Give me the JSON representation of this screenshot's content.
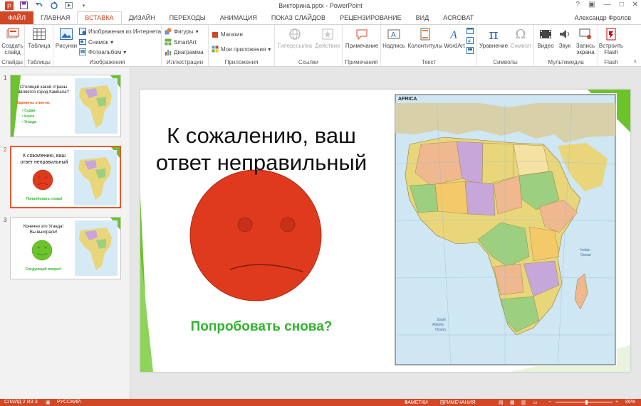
{
  "titlebar": {
    "title": "Викторина.pptx - PowerPoint",
    "qat_icons": [
      "powerpoint-logo",
      "save-icon",
      "undo-icon",
      "redo-icon",
      "start-from-beginning-icon"
    ]
  },
  "tabs": [
    {
      "label": "ФАЙЛ",
      "name": "tab-file"
    },
    {
      "label": "ГЛАВНАЯ",
      "name": "tab-home"
    },
    {
      "label": "ВСТАВКА",
      "name": "tab-insert"
    },
    {
      "label": "ДИЗАЙН",
      "name": "tab-design"
    },
    {
      "label": "ПЕРЕХОДЫ",
      "name": "tab-transitions"
    },
    {
      "label": "АНИМАЦИЯ",
      "name": "tab-animation"
    },
    {
      "label": "ПОКАЗ СЛАЙДОВ",
      "name": "tab-slideshow"
    },
    {
      "label": "РЕЦЕНЗИРОВАНИЕ",
      "name": "tab-review"
    },
    {
      "label": "ВИД",
      "name": "tab-view"
    },
    {
      "label": "ACROBAT",
      "name": "tab-acrobat"
    }
  ],
  "user": "Александр Фролов",
  "ribbon": {
    "slides": {
      "btn": "Создать слайд",
      "label": "Слайды"
    },
    "tables": {
      "btn": "Таблица",
      "label": "Таблицы"
    },
    "images": {
      "pictures": "Рисунки",
      "online": "Изображения из Интернета",
      "screenshot": "Снимок",
      "album": "Фотоальбом",
      "label": "Изображения"
    },
    "illustrations": {
      "shapes": "Фигуры",
      "smartart": "SmartArt",
      "chart": "Диаграмма",
      "label": "Иллюстрации"
    },
    "apps": {
      "store": "Магазин",
      "myapps": "Мои приложения",
      "label": "Приложения"
    },
    "links": {
      "hyperlink": "Гиперссылка",
      "action": "Действие",
      "label": "Ссылки"
    },
    "comments": {
      "comment": "Примечание",
      "label": "Примечания"
    },
    "text": {
      "textbox": "Надпись",
      "headerfooter": "Колонтитулы",
      "wordart": "WordArt",
      "label": "Текст"
    },
    "symbols": {
      "equation": "Уравнение",
      "symbol": "Символ",
      "label": "Символы"
    },
    "media": {
      "video": "Видео",
      "audio": "Звук",
      "record": "Запись экрана",
      "label": "Мультимедиа"
    },
    "flash": {
      "embed": "Встроить Flash",
      "label": "Flash"
    }
  },
  "thumbnails": [
    {
      "num": "1",
      "line1": "Столицей какой страны",
      "line2": "является город Кампала?",
      "opt_title": "Варианты ответов:",
      "opts": [
        "Судан",
        "Конго",
        "Уганда"
      ]
    },
    {
      "num": "2",
      "line1": "К сожалению, ваш",
      "line2": "ответ неправильный",
      "link": "Попробовать снова!"
    },
    {
      "num": "3",
      "line1": "Конечно это Уганда!",
      "line2": "Вы выиграли!",
      "link": "Следующий вопрос!"
    }
  ],
  "slide": {
    "title_line1": "К сожалению, ваш",
    "title_line2": "ответ неправильный",
    "link_text": "Попробовать снова?",
    "map_title": "AFRICA"
  },
  "statusbar": {
    "slide_info": "СЛАЙД 2 ИЗ 3",
    "language": "РУССКИЙ",
    "notes": "ЗАМЕТКИ",
    "comments": "ПРИМЕЧАНИЯ",
    "zoom": "86%"
  },
  "colors": {
    "accent": "#d24726",
    "sad_face": "#e03a1e",
    "happy_face": "#6ac42a",
    "link_green": "#2fb52f",
    "slide_green": "#6ac42a"
  }
}
